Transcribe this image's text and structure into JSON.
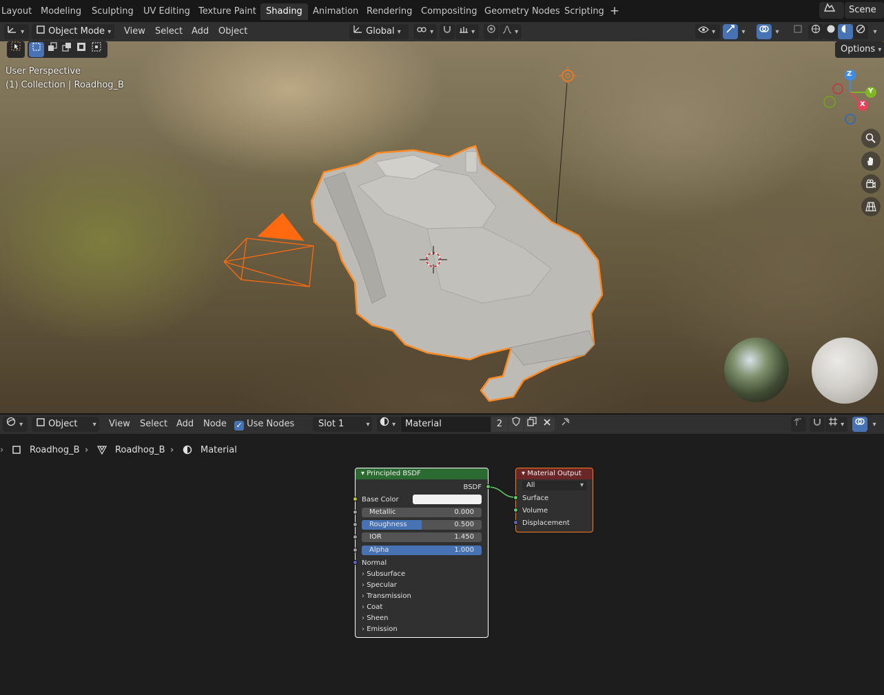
{
  "workspace_tabs": [
    "Layout",
    "Modeling",
    "Sculpting",
    "UV Editing",
    "Texture Paint",
    "Shading",
    "Animation",
    "Rendering",
    "Compositing",
    "Geometry Nodes",
    "Scripting"
  ],
  "active_tab": "Shading",
  "scene_label": "Scene",
  "viewport_header": {
    "mode": "Object Mode",
    "menus": [
      "View",
      "Select",
      "Add",
      "Object"
    ],
    "transform_orientation": "Global"
  },
  "viewport": {
    "perspective_label": "User Perspective",
    "collection_label": "(1) Collection | Roadhog_B",
    "options_label": "Options",
    "gizmo_axes": [
      "Z",
      "Y",
      "X"
    ]
  },
  "node_header": {
    "editor_mode": "Object",
    "menus": [
      "View",
      "Select",
      "Add",
      "Node"
    ],
    "use_nodes_label": "Use Nodes",
    "use_nodes_checked": true,
    "slot": "Slot 1",
    "material_name": "Material",
    "user_count": "2"
  },
  "breadcrumb": [
    "Roadhog_B",
    "Roadhog_B",
    "Material"
  ],
  "principled": {
    "title": "Principled BSDF",
    "output_label": "BSDF",
    "base_color_label": "Base Color",
    "base_color": "#f2f2f2",
    "fields": [
      {
        "label": "Metallic",
        "value": "0.000",
        "fraction": 0.0
      },
      {
        "label": "Roughness",
        "value": "0.500",
        "fraction": 0.5
      },
      {
        "label": "IOR",
        "value": "1.450",
        "fraction": 0.0
      },
      {
        "label": "Alpha",
        "value": "1.000",
        "fraction": 1.0
      }
    ],
    "normal_label": "Normal",
    "panels": [
      "Subsurface",
      "Specular",
      "Transmission",
      "Coat",
      "Sheen",
      "Emission"
    ]
  },
  "material_output": {
    "title": "Material Output",
    "target": "All",
    "inputs": [
      "Surface",
      "Volume",
      "Displacement"
    ]
  },
  "colors": {
    "accent_blue": "#4772b3",
    "selection_orange": "#ff7a1a",
    "shader_header": "#2b6b32",
    "output_header": "#6b2628",
    "socket_shader": "#63c763",
    "socket_color": "#c7c729",
    "socket_float": "#a1a1a1",
    "socket_vector": "#6363c7"
  }
}
